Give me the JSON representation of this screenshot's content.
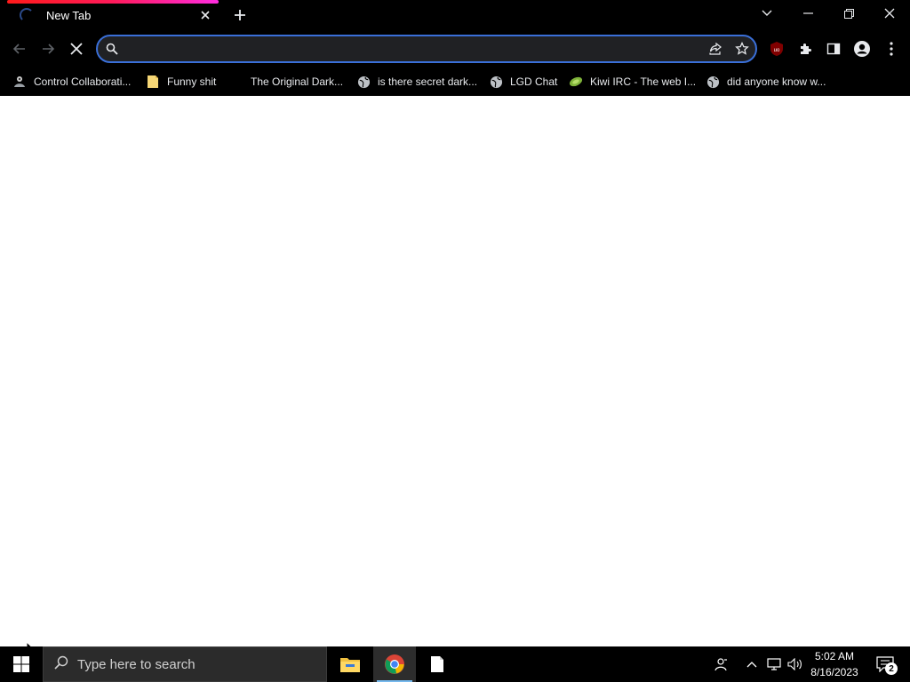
{
  "browser": {
    "tab": {
      "title": "New Tab",
      "loading": true
    },
    "omnibox": {
      "value": "",
      "placeholder": ""
    },
    "bookmarks": [
      {
        "label": "Control Collaborati...",
        "icon": "collab-icon"
      },
      {
        "label": "Funny shit",
        "icon": "note-icon"
      },
      {
        "label": "The Original Dark...",
        "icon": "blank-icon"
      },
      {
        "label": "is there secret dark...",
        "icon": "globe-icon"
      },
      {
        "label": "LGD Chat",
        "icon": "globe-icon"
      },
      {
        "label": "Kiwi IRC - The web I...",
        "icon": "kiwi-icon"
      },
      {
        "label": "did anyone know w...",
        "icon": "globe-icon"
      }
    ],
    "extension_badge": "uo"
  },
  "taskbar": {
    "search_placeholder": "Type here to search",
    "clock": {
      "time": "5:02 AM",
      "date": "8/16/2023"
    },
    "notification_count": "2"
  },
  "colors": {
    "accent_focus": "#3a6fd8",
    "tab_progress_start": "#ff1a1a",
    "tab_progress_end": "#ff2de0",
    "taskbar_active_underline": "#76b9ed"
  }
}
